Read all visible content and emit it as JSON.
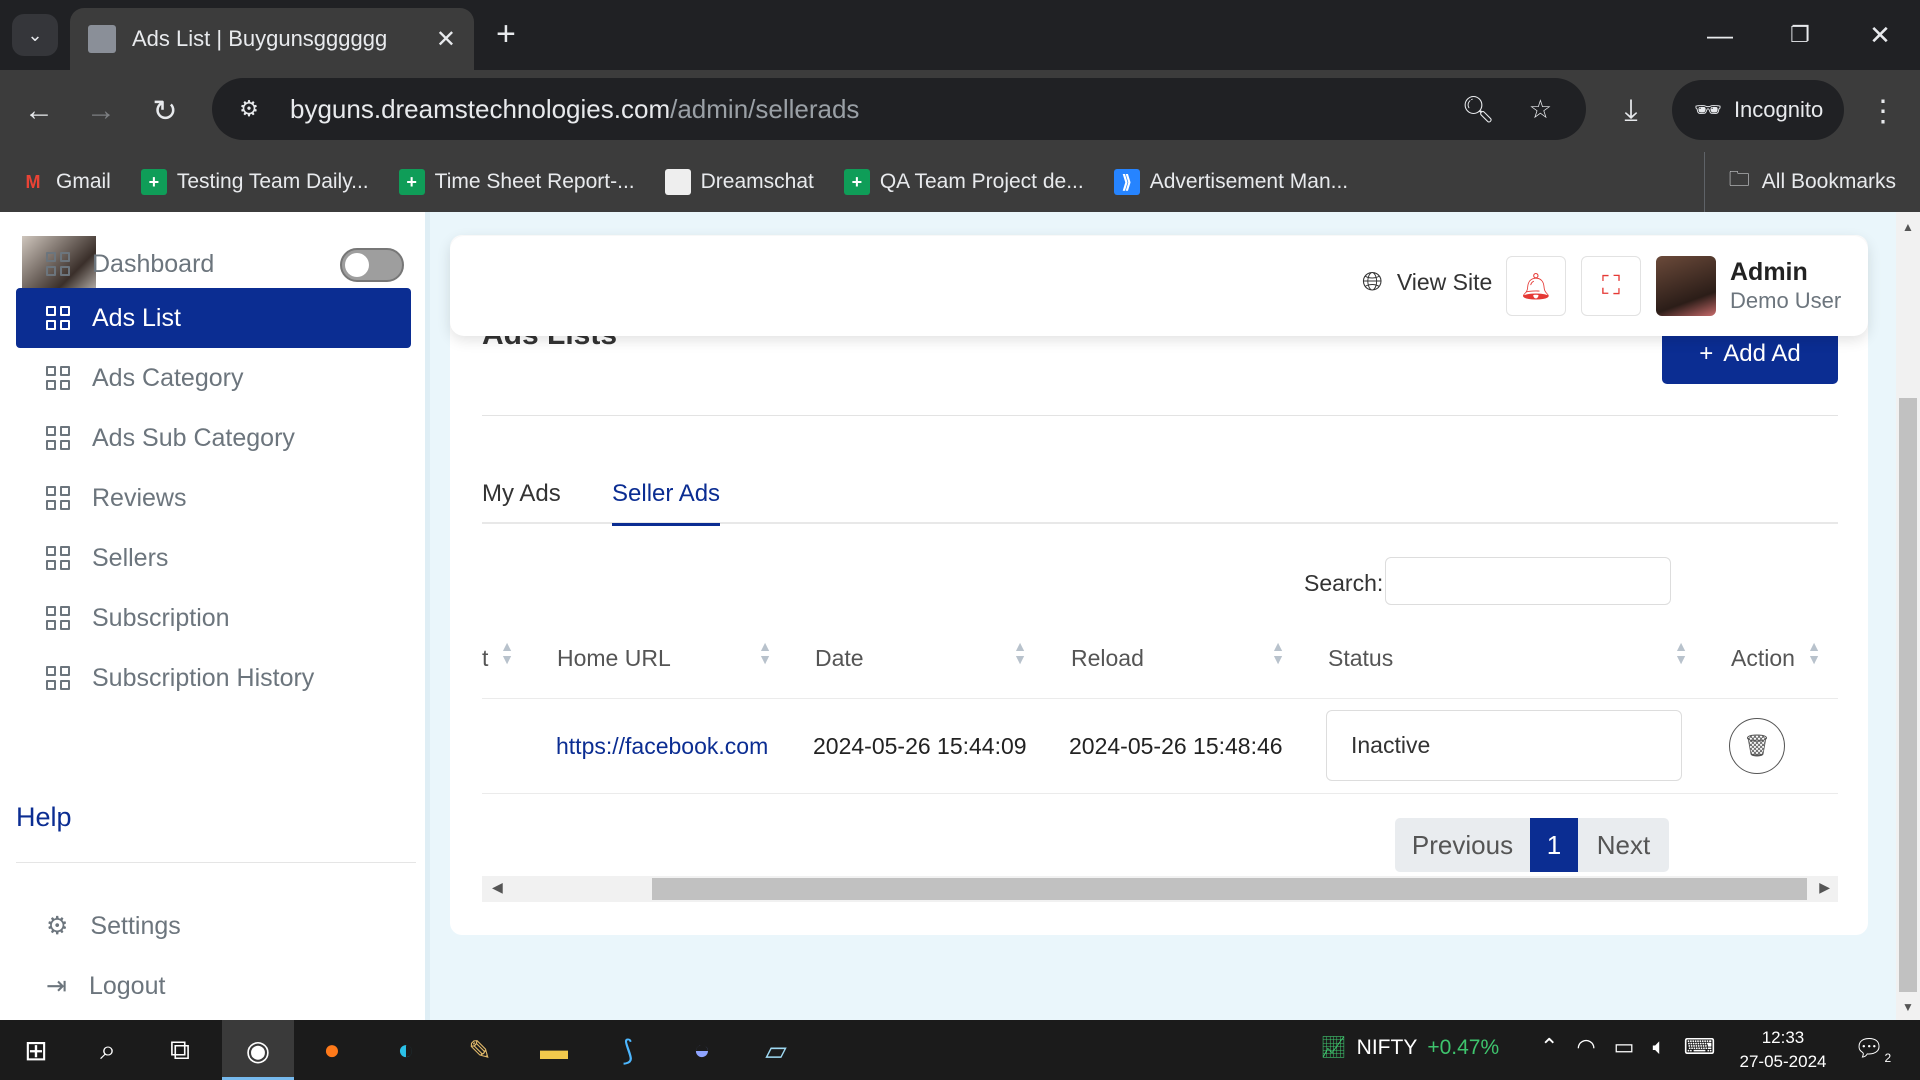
{
  "browser": {
    "tab_title": "Ads List | Buygunsgggggg",
    "url_main": "byguns.dreamstechnologies.com",
    "url_path": "/admin/sellerads",
    "incognito_label": "Incognito",
    "bookmarks": [
      {
        "label": "Gmail",
        "icon": "gmail-icon",
        "color": "#ea4335"
      },
      {
        "label": "Testing Team Daily...",
        "icon": "sheets-icon",
        "color": "#0f9d58"
      },
      {
        "label": "Time Sheet Report-...",
        "icon": "sheets-icon",
        "color": "#0f9d58"
      },
      {
        "label": "Dreamschat",
        "icon": "dreams-icon",
        "color": "#ffffff"
      },
      {
        "label": "QA Team Project de...",
        "icon": "sheets-icon",
        "color": "#0f9d58"
      },
      {
        "label": "Advertisement Man...",
        "icon": "jira-icon",
        "color": "#2684ff"
      }
    ],
    "all_bookmarks_label": "All Bookmarks"
  },
  "sidebar": {
    "items": [
      {
        "label": "Dashboard",
        "active": false
      },
      {
        "label": "Ads List",
        "active": true
      },
      {
        "label": "Ads Category",
        "active": false
      },
      {
        "label": "Ads Sub Category",
        "active": false
      },
      {
        "label": "Reviews",
        "active": false
      },
      {
        "label": "Sellers",
        "active": false
      },
      {
        "label": "Subscription",
        "active": false
      },
      {
        "label": "Subscription History",
        "active": false
      }
    ],
    "help_heading": "Help",
    "settings_label": "Settings",
    "logout_label": "Logout"
  },
  "header": {
    "view_site_label": "View Site",
    "user_name": "Admin",
    "user_role": "Demo User"
  },
  "main": {
    "page_title": "Ads Lists",
    "add_button_label": "Add Ad",
    "tabs": [
      {
        "label": "My Ads",
        "active": false
      },
      {
        "label": "Seller Ads",
        "active": true
      }
    ],
    "search_label": "Search:",
    "search_value": "",
    "columns": [
      "t",
      "Home URL",
      "Date",
      "Reload",
      "Status",
      "Action"
    ],
    "rows": [
      {
        "home_url": "https://facebook.com",
        "date": "2024-05-26 15:44:09",
        "reload": "2024-05-26 15:48:46",
        "status": "Inactive"
      }
    ],
    "pagination": {
      "previous": "Previous",
      "current": "1",
      "next": "Next"
    }
  },
  "taskbar": {
    "ticker_name": "NIFTY",
    "ticker_change": "+0.47%",
    "time": "12:33",
    "date": "27-05-2024",
    "notification_count": "2"
  },
  "colors": {
    "primary": "#0b2d92",
    "danger": "#e53935",
    "positive": "#3ec46d"
  }
}
